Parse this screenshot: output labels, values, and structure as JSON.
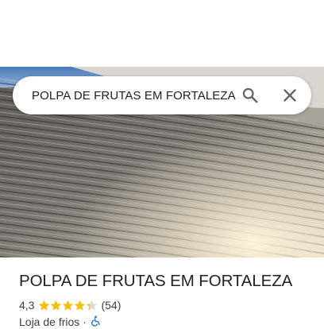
{
  "search": {
    "query": "POLPA DE FRUTAS EM FORTALEZA",
    "icons": [
      "search-icon",
      "close-icon"
    ]
  },
  "place": {
    "name": "POLPA DE FRUTAS EM FORTALEZA",
    "rating": "4,3",
    "stars": 4.3,
    "reviews": "(54)",
    "category": "Loja de frios",
    "separator": "·",
    "accessibility_icon": "wheelchair-icon"
  },
  "colors": {
    "star": "#fbbc04",
    "star_empty": "#dadce0",
    "text": "#202124",
    "secondary_text": "#3c4043",
    "accessibility": "#1a73e8"
  }
}
